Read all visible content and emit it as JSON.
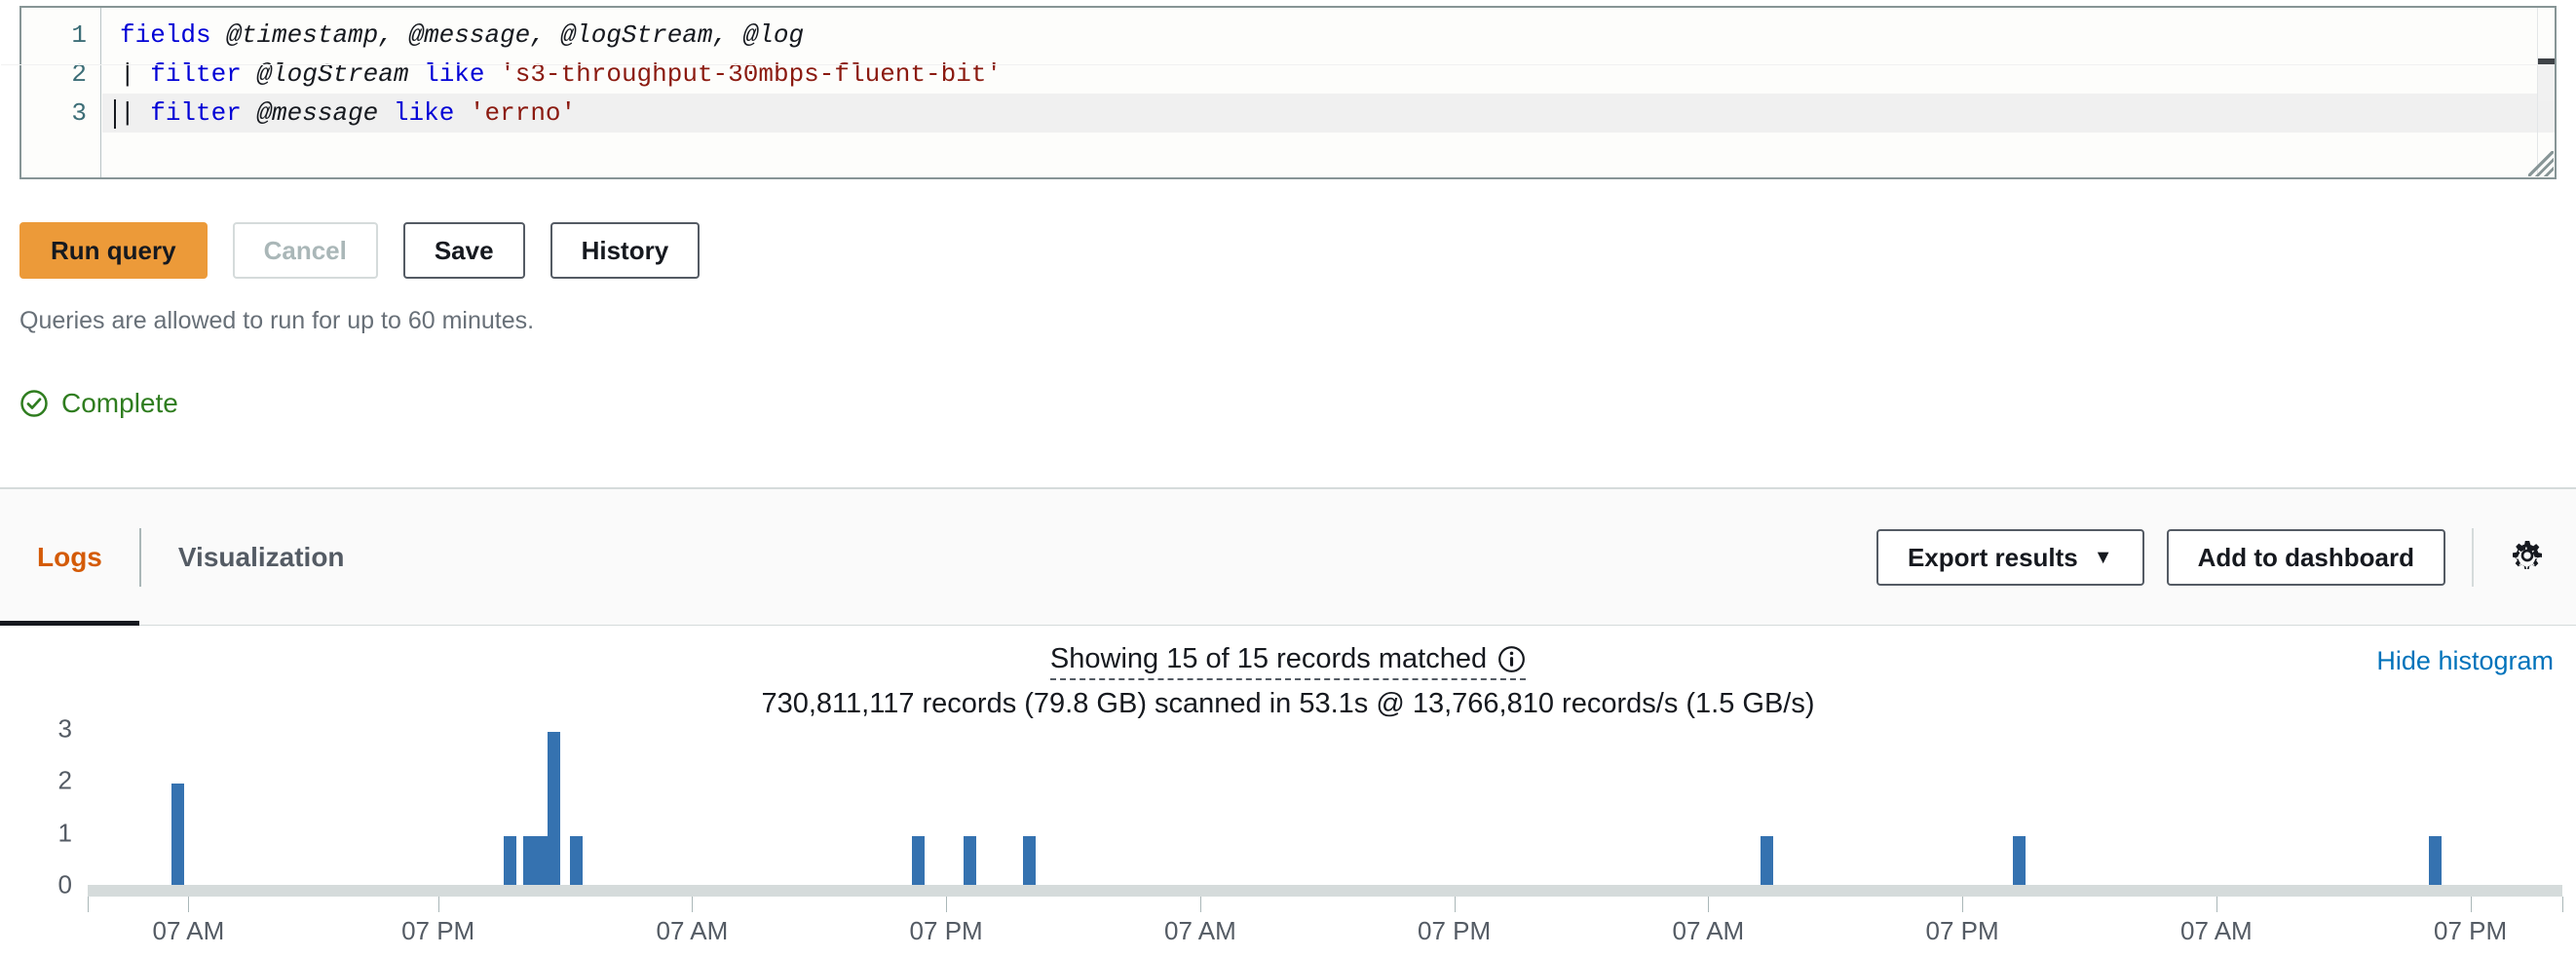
{
  "editor": {
    "line_numbers": [
      "1",
      "2",
      "3"
    ],
    "lines": [
      {
        "tokens": [
          {
            "t": "fields",
            "c": "kw"
          },
          {
            "t": " ",
            "c": "dot"
          },
          {
            "t": "@timestamp, @message, @logStream, @log",
            "c": "fld"
          }
        ]
      },
      {
        "tokens": [
          {
            "t": "| ",
            "c": "pnc"
          },
          {
            "t": "filter",
            "c": "kw"
          },
          {
            "t": " ",
            "c": "dot"
          },
          {
            "t": "@logStream",
            "c": "fld"
          },
          {
            "t": " ",
            "c": "dot"
          },
          {
            "t": "like",
            "c": "kw"
          },
          {
            "t": " ",
            "c": "dot"
          },
          {
            "t": "'s3-throughput-30mbps-fluent-bit'",
            "c": "str"
          }
        ]
      },
      {
        "tokens": [
          {
            "t": "| ",
            "c": "pnc"
          },
          {
            "t": "filter",
            "c": "kw"
          },
          {
            "t": " ",
            "c": "dot"
          },
          {
            "t": "@message",
            "c": "fld"
          },
          {
            "t": " ",
            "c": "dot"
          },
          {
            "t": "like",
            "c": "kw"
          },
          {
            "t": " ",
            "c": "dot"
          },
          {
            "t": "'errno'",
            "c": "str"
          }
        ]
      }
    ],
    "query_text_line1": "fields @timestamp, @message, @logStream, @log",
    "query_text_line2": "| filter @logStream like 's3-throughput-30mbps-fluent-bit'",
    "query_text_line3": "| filter @message like 'errno'"
  },
  "toolbar": {
    "run_label": "Run query",
    "cancel_label": "Cancel",
    "save_label": "Save",
    "history_label": "History",
    "hint": "Queries are allowed to run for up to 60 minutes.",
    "primary_color": "#ec9a39"
  },
  "status": {
    "label": "Complete",
    "icon": "check-circle-icon",
    "color": "#2f7d1f"
  },
  "tabs": [
    {
      "label": "Logs",
      "active": true
    },
    {
      "label": "Visualization",
      "active": false
    }
  ],
  "actions": {
    "export_label": "Export results",
    "export_caret": "▼",
    "dashboard_label": "Add to dashboard",
    "gear_icon": "gear-icon"
  },
  "results": {
    "records_text": "Showing 15 of 15 records matched",
    "info_icon": "info-icon",
    "scan_text": "730,811,117 records (79.8 GB) scanned in 53.1s @ 13,766,810 records/s (1.5 GB/s)",
    "hide_histogram_label": "Hide histogram",
    "link_color": "#0073bb",
    "records_shown": 15,
    "records_matched": 15,
    "records_scanned": "730,811,117",
    "bytes_scanned": "79.8 GB",
    "scan_duration": "53.1s",
    "scan_rate_records": "13,766,810 records/s",
    "scan_rate_bytes": "1.5 GB/s"
  },
  "chart_data": {
    "type": "bar",
    "title": "",
    "xlabel": "",
    "ylabel": "",
    "ylim": [
      0,
      3
    ],
    "yticks": [
      0,
      1,
      2,
      3
    ],
    "grid": false,
    "legend": null,
    "bar_color": "#3572b0",
    "xtick_labels": [
      "07 AM",
      "07 PM",
      "07 AM",
      "07 PM",
      "07 AM",
      "07 PM",
      "07 AM",
      "07 PM",
      "07 AM",
      "07 PM"
    ],
    "xtick_positions_pct": [
      2.3,
      8.0,
      13.8,
      19.6,
      25.4,
      31.2,
      37.0,
      42.8,
      48.6,
      54.4
    ],
    "bars": [
      {
        "x_pct": 3.4,
        "value": 2
      },
      {
        "x_pct": 16.8,
        "value": 1
      },
      {
        "x_pct": 17.6,
        "value": 1
      },
      {
        "x_pct": 18.1,
        "value": 1
      },
      {
        "x_pct": 18.6,
        "value": 3
      },
      {
        "x_pct": 19.5,
        "value": 1
      },
      {
        "x_pct": 33.3,
        "value": 1
      },
      {
        "x_pct": 35.4,
        "value": 1
      },
      {
        "x_pct": 37.8,
        "value": 1
      },
      {
        "x_pct": 67.6,
        "value": 1
      },
      {
        "x_pct": 77.8,
        "value": 1
      },
      {
        "x_pct": 94.6,
        "value": 1
      }
    ],
    "values": [
      2,
      1,
      1,
      1,
      3,
      1,
      1,
      1,
      1,
      1,
      1,
      1
    ]
  }
}
